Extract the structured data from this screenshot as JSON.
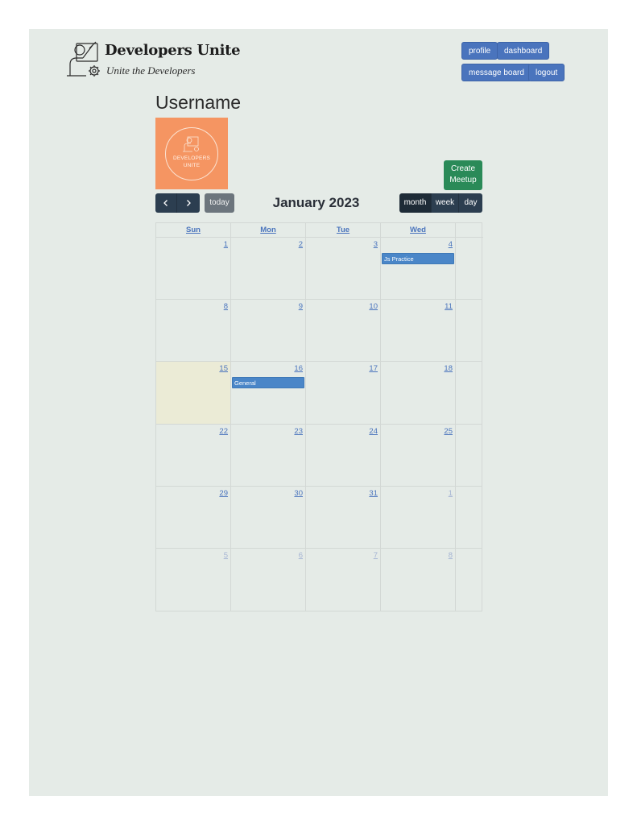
{
  "brand": {
    "title": "Developers Unite",
    "tagline": "Unite the Developers",
    "logo_icon": "developer-gear-icon"
  },
  "nav": {
    "profile": "profile",
    "dashboard": "dashboard",
    "message_board": "message board",
    "logout": "logout",
    "color": "#4a74bd"
  },
  "profile": {
    "username": "Username",
    "avatar_text_line1": "DEVELOPERS",
    "avatar_text_line2": "UNITE",
    "avatar_color": "#f59562"
  },
  "actions": {
    "create_line1": "Create",
    "create_line2": "Meetup"
  },
  "calendar": {
    "title": "January 2023",
    "prev_icon": "chevron-left-icon",
    "next_icon": "chevron-right-icon",
    "today_label": "today",
    "views": [
      "month",
      "week",
      "day"
    ],
    "active_view": "month",
    "days_of_week": [
      "Sun",
      "Mon",
      "Tue",
      "Wed"
    ],
    "weeks": [
      [
        {
          "d": "1"
        },
        {
          "d": "2"
        },
        {
          "d": "3"
        },
        {
          "d": "4",
          "event": "Js Practice"
        }
      ],
      [
        {
          "d": "8"
        },
        {
          "d": "9"
        },
        {
          "d": "10"
        },
        {
          "d": "11"
        }
      ],
      [
        {
          "d": "15",
          "today": true
        },
        {
          "d": "16",
          "event": "General"
        },
        {
          "d": "17"
        },
        {
          "d": "18"
        }
      ],
      [
        {
          "d": "22"
        },
        {
          "d": "23"
        },
        {
          "d": "24"
        },
        {
          "d": "25"
        }
      ],
      [
        {
          "d": "29"
        },
        {
          "d": "30"
        },
        {
          "d": "31"
        },
        {
          "d": "1",
          "other": true
        }
      ],
      [
        {
          "d": "5",
          "other": true
        },
        {
          "d": "6",
          "other": true
        },
        {
          "d": "7",
          "other": true
        },
        {
          "d": "8",
          "other": true
        }
      ]
    ],
    "event_color": "#4a86c8",
    "today_color": "#ebebd6"
  }
}
